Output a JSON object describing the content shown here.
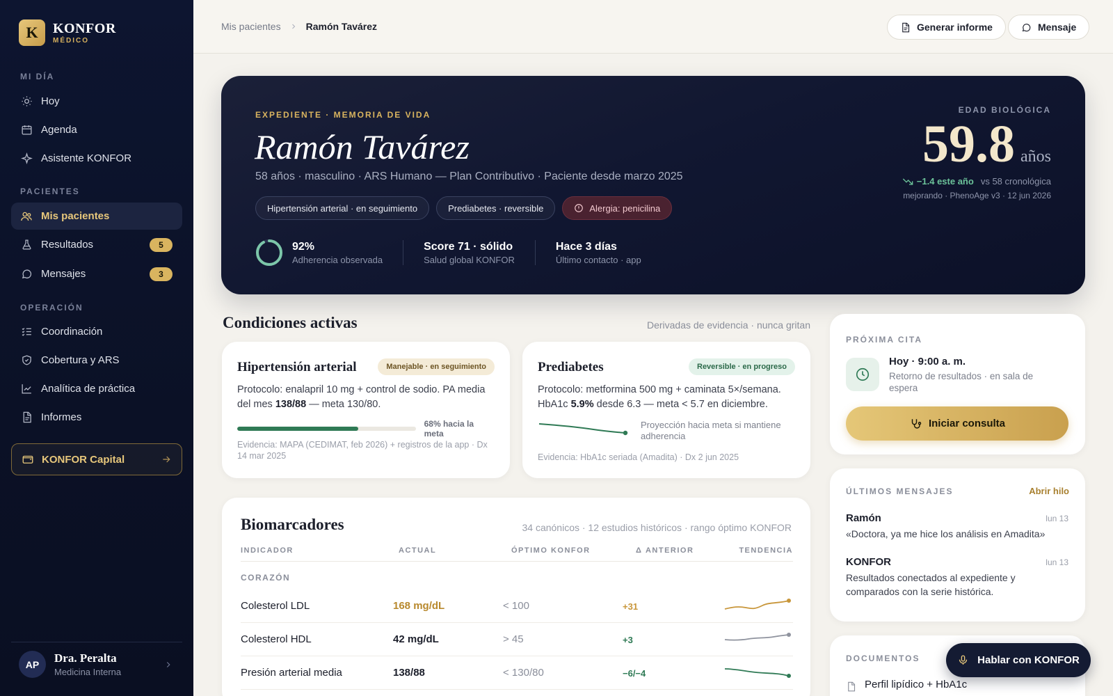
{
  "brand": {
    "mark": "K",
    "name": "KONFOR",
    "sub": "MÉDICO"
  },
  "nav": {
    "sections": {
      "day": "MI DÍA",
      "patients": "PACIENTES",
      "operation": "OPERACIÓN"
    },
    "items": {
      "today": "Hoy",
      "agenda": "Agenda",
      "assistant": "Asistente KONFOR",
      "patients": "Mis pacientes",
      "results": "Resultados",
      "results_badge": "5",
      "messages": "Mensajes",
      "messages_badge": "3",
      "coordination": "Coordinación",
      "coverage": "Cobertura y ARS",
      "analytics": "Analítica de práctica",
      "reports": "Informes"
    },
    "capital": "KONFOR Capital"
  },
  "user": {
    "initials": "AP",
    "name": "Dra. Peralta",
    "role": "Medicina Interna"
  },
  "topbar": {
    "crumb_parent": "Mis pacientes",
    "crumb_current": "Ramón Tavárez",
    "report_btn": "Generar informe",
    "message_btn": "Mensaje"
  },
  "hero": {
    "kicker": "EXPEDIENTE · MEMORIA DE VIDA",
    "name": "Ramón Tavárez",
    "meta": "58 años · masculino · ARS Humano — Plan Contributivo · Paciente desde marzo 2025",
    "chips": [
      "Hipertensión arterial · en seguimiento",
      "Prediabetes · reversible",
      "Alergia: penicilina"
    ],
    "adherence": {
      "value": "92%",
      "fraction": 0.92,
      "label": "Adherencia observada"
    },
    "score": {
      "value": "Score 71 · sólido",
      "label": "Salud global KONFOR"
    },
    "contact": {
      "value": "Hace 3 días",
      "label": "Último contacto · app"
    },
    "bio": {
      "kicker": "EDAD BIOLÓGICA",
      "value": "59.8",
      "unit": "años",
      "delta": "−1.4 este año",
      "vs": "vs 58 cronológica",
      "source": "mejorando · PhenoAge v3 · 12 jun 2026"
    }
  },
  "conditions": {
    "title": "Condiciones activas",
    "note": "Derivadas de evidencia · nunca gritan",
    "htn": {
      "title": "Hipertensión arterial",
      "tag": "Manejable · en seguimiento",
      "body_a": "Protocolo: enalapril 10 mg + control de sodio. PA media del mes ",
      "body_b": "138/88",
      "body_c": " — meta 130/80.",
      "progress": 0.68,
      "progress_label": "68% hacia la meta",
      "evidence": "Evidencia: MAPA (CEDIMAT, feb 2026) + registros de la app · Dx 14 mar 2025"
    },
    "pred": {
      "title": "Prediabetes",
      "tag": "Reversible · en progreso",
      "body_a": "Protocolo: metformina 500 mg + caminata 5×/semana. HbA1c ",
      "body_b": "5.9%",
      "body_c": " desde 6.3 — meta < 5.7 en diciembre.",
      "projection": "Proyección hacia meta si mantiene adherencia",
      "evidence": "Evidencia: HbA1c seriada (Amadita) · Dx 2 jun 2025"
    }
  },
  "biomarkers": {
    "title": "Biomarcadores",
    "note": "34 canónicos · 12 estudios históricos · rango óptimo KONFOR",
    "headers": [
      "INDICADOR",
      "ACTUAL",
      "ÓPTIMO KONFOR",
      "Δ ANTERIOR",
      "TENDENCIA"
    ],
    "group": "CORAZÓN",
    "rows": [
      {
        "name": "Colesterol LDL",
        "value": "168 mg/dL",
        "optimal": "< 100",
        "delta": "+31"
      },
      {
        "name": "Colesterol HDL",
        "value": "42 mg/dL",
        "optimal": "> 45",
        "delta": "+3"
      },
      {
        "name": "Presión arterial media",
        "value": "138/88",
        "optimal": "< 130/80",
        "delta": "−6/−4"
      }
    ],
    "colors": {
      "high": "#c8963a",
      "neutral": "#8f939e",
      "good": "#2f7a55"
    }
  },
  "appointment": {
    "kicker": "PRÓXIMA CITA",
    "time": "Hoy · 9:00 a. m.",
    "desc": "Retorno de resultados · en sala de espera",
    "button": "Iniciar consulta"
  },
  "messages": {
    "kicker": "ÚLTIMOS MENSAJES",
    "open": "Abrir hilo",
    "items": [
      {
        "from": "Ramón",
        "date": "lun 13",
        "text": "«Doctora, ya me hice los análisis en Amadita»"
      },
      {
        "from": "KONFOR",
        "date": "lun 13",
        "text": "Resultados conectados al expediente y comparados con la serie histórica."
      }
    ]
  },
  "documents": {
    "kicker": "DOCUMENTOS",
    "first": "Perfil lipídico + HbA1c"
  },
  "fab": "Hablar con KONFOR"
}
